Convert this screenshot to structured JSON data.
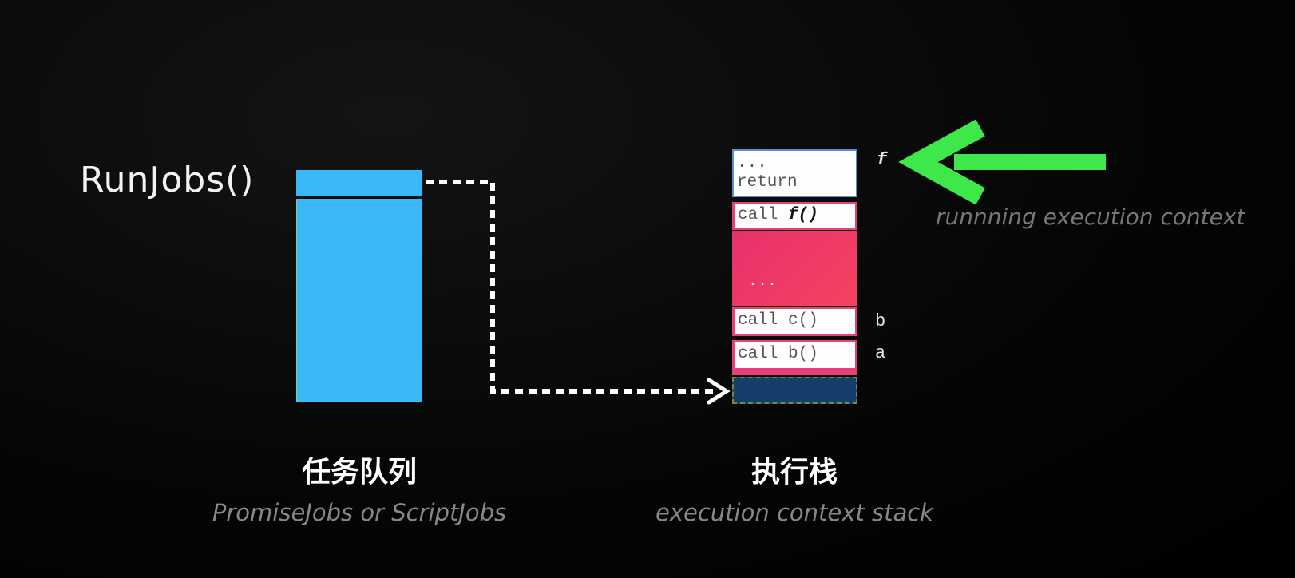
{
  "left": {
    "label": "RunJobs()",
    "title": "任务队列",
    "subtitle": "PromiseJobs or ScriptJobs"
  },
  "right": {
    "title": "执行栈",
    "subtitle": "execution context stack",
    "stack": {
      "frame_f_line1": "...",
      "frame_f_line2": "return",
      "call_f_prefix": "call ",
      "call_f_name": "f()",
      "middle_dots": "...",
      "call_c": "call c()",
      "call_b": "call b()"
    },
    "side_labels": {
      "f": "f",
      "b": "b",
      "a": "a"
    },
    "running_label": "runnning execution context"
  },
  "colors": {
    "queue": "#3ab8f8",
    "stack_red": "#e8407a",
    "base": "#163e6c",
    "arrow_green": "#3fe84a",
    "dashed": "#ffffff"
  }
}
